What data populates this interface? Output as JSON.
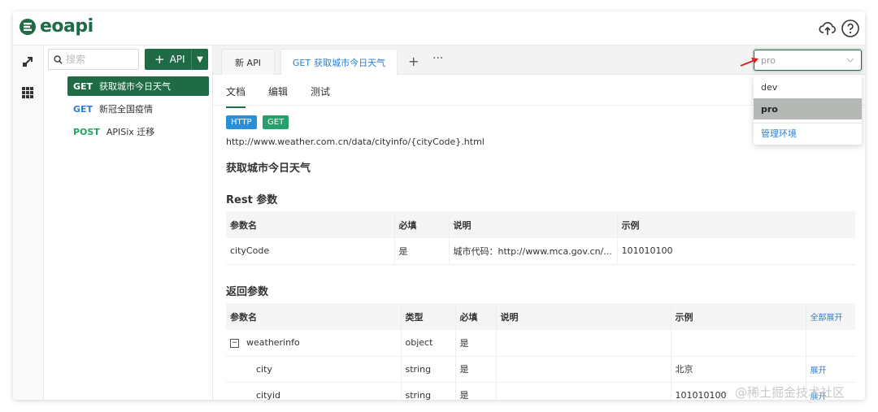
{
  "header": {
    "logo_text": "eoapi"
  },
  "rail": {
    "icons": [
      "api-share-icon",
      "apps-grid-icon"
    ]
  },
  "sidebar": {
    "search_placeholder": "搜索",
    "add_button_label": "API",
    "items": [
      {
        "method": "GET",
        "label": "获取城市今日天气",
        "active": true
      },
      {
        "method": "GET",
        "label": "新冠全国疫情",
        "active": false
      },
      {
        "method": "POST",
        "label": "APISix 迁移",
        "active": false
      }
    ]
  },
  "tabs": [
    {
      "label": "新 API",
      "active": false
    },
    {
      "method": "GET",
      "label": "获取城市今日天气",
      "active": true
    }
  ],
  "tab_more": "···",
  "environment": {
    "placeholder": "pro",
    "options": [
      "dev",
      "pro"
    ],
    "selected": "pro",
    "manage_label": "管理环境"
  },
  "subtabs": [
    "文档",
    "编辑",
    "测试"
  ],
  "badges": {
    "protocol": "HTTP",
    "method": "GET"
  },
  "api": {
    "url": "http://www.weather.com.cn/data/cityinfo/{cityCode}.html",
    "name": "获取城市今日天气"
  },
  "rest_params": {
    "title": "Rest 参数",
    "headers": [
      "参数名",
      "必填",
      "说明",
      "示例"
    ],
    "rows": [
      [
        "cityCode",
        "是",
        "城市代码：http://www.mca.gov.cn/...",
        "101010100"
      ]
    ]
  },
  "return_params": {
    "title": "返回参数",
    "headers": [
      "参数名",
      "类型",
      "必填",
      "说明",
      "示例"
    ],
    "expand_all": "全部展开",
    "rows": [
      {
        "name": "weatherinfo",
        "type": "object",
        "required": "是",
        "desc": "",
        "example": "",
        "action": ""
      },
      {
        "name": "city",
        "type": "string",
        "required": "是",
        "desc": "",
        "example": "北京",
        "action": "展开"
      },
      {
        "name": "cityid",
        "type": "string",
        "required": "是",
        "desc": "",
        "example": "101010100",
        "action": "展开"
      }
    ]
  },
  "watermark": "@稀土掘金技术社区",
  "colors": {
    "brand": "#1e6b45",
    "link": "#2b7fd3",
    "post": "#21a366"
  }
}
